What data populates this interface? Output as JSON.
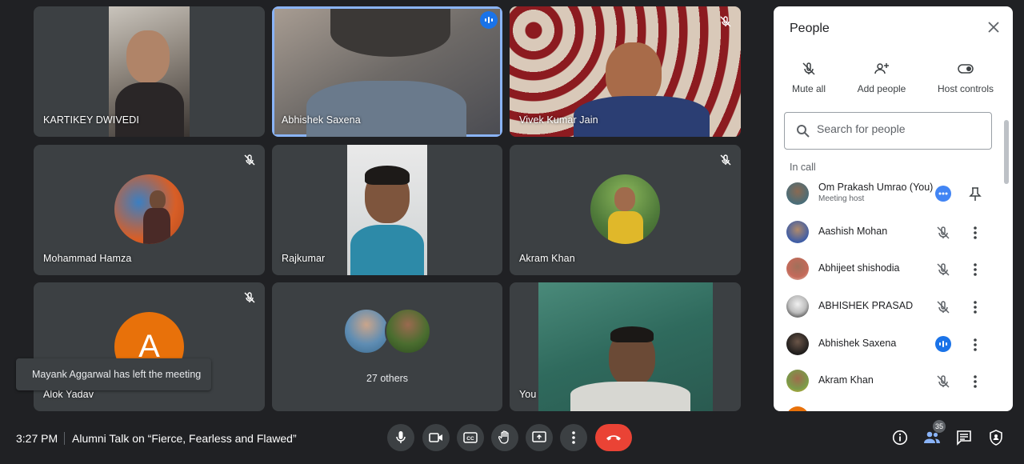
{
  "tiles": {
    "kartikey": {
      "name": "KARTIKEY DWIVEDI"
    },
    "abhishek": {
      "name": "Abhishek Saxena"
    },
    "vivek": {
      "name": "Vivek Kumar Jain"
    },
    "hamza": {
      "name": "Mohammad Hamza"
    },
    "rajkumar": {
      "name": "Rajkumar"
    },
    "akram": {
      "name": "Akram Khan"
    },
    "alok": {
      "name": "Alok Yadav",
      "initial": "A"
    },
    "others": {
      "label": "27 others"
    },
    "you": {
      "name": "You"
    }
  },
  "toast": {
    "text": "Mayank Aggarwal has left the meeting"
  },
  "bottom_bar": {
    "time": "3:27 PM",
    "meeting_title": "Alumni Talk on “Fierce, Fearless and Flawed”",
    "participant_count": "35"
  },
  "people_panel": {
    "title": "People",
    "actions": {
      "mute_all": "Mute all",
      "add_people": "Add people",
      "host_controls": "Host controls"
    },
    "search_placeholder": "Search for people",
    "section_label": "In call",
    "participants": [
      {
        "name": "Om Prakash Umrao (You)",
        "sub": "Meeting host"
      },
      {
        "name": "Aashish Mohan"
      },
      {
        "name": "Abhijeet shishodia"
      },
      {
        "name": "ABHISHEK PRASAD"
      },
      {
        "name": "Abhishek Saxena"
      },
      {
        "name": "Akram Khan"
      }
    ]
  },
  "colors": {
    "accent": "#1a73e8",
    "end_call": "#ea4335",
    "tile_bg": "#3c4043",
    "page_bg": "#202124"
  }
}
